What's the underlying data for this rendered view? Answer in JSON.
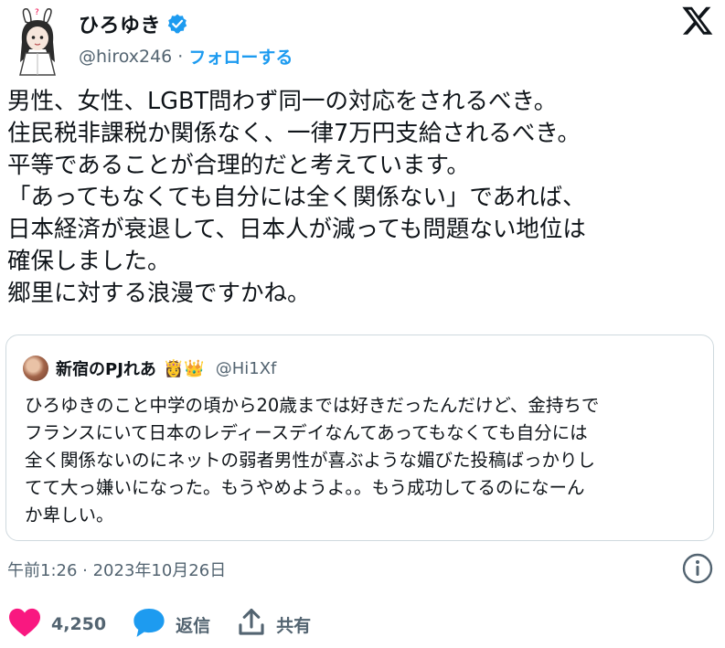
{
  "header": {
    "display_name": "ひろゆき",
    "handle": "@hirox246",
    "separator": "·",
    "follow_label": "フォローする"
  },
  "tweet": {
    "text": "男性、女性、LGBT問わず同一の対応をされるべき。\n住民税非課税か関係なく、一律7万円支給されるべき。\n平等であることが合理的だと考えています。\n「あってもなくても自分には全く関係ない」であれば、\n日本経済が衰退して、日本人が減っても問題ない地位は\n確保しました。\n郷里に対する浪漫ですかね。"
  },
  "quote": {
    "name": "新宿のPJれあ",
    "emoji": "👸👑",
    "handle": "@Hi1Xf",
    "text": "ひろゆきのこと中学の頃から20歳までは好きだったんだけど、金持ちで\nフランスにいて日本のレディースデイなんてあってもなくても自分には\n全く関係ないのにネットの弱者男性が喜ぶような媚びた投稿ばっかりし\nてて大っ嫌いになった。もうやめようよ。。もう成功してるのになーん\nか卑しい。"
  },
  "meta": {
    "timestamp": "午前1:26 · 2023年10月26日"
  },
  "actions": {
    "like_count": "4,250",
    "reply_label": "返信",
    "share_label": "共有"
  },
  "colors": {
    "accent": "#1d9bf0",
    "like": "#f91880",
    "secondary_text": "#536471",
    "border": "#cfd9de"
  },
  "icons": [
    "verified-badge-icon",
    "x-logo-icon",
    "info-icon",
    "heart-icon",
    "reply-icon",
    "share-icon"
  ]
}
